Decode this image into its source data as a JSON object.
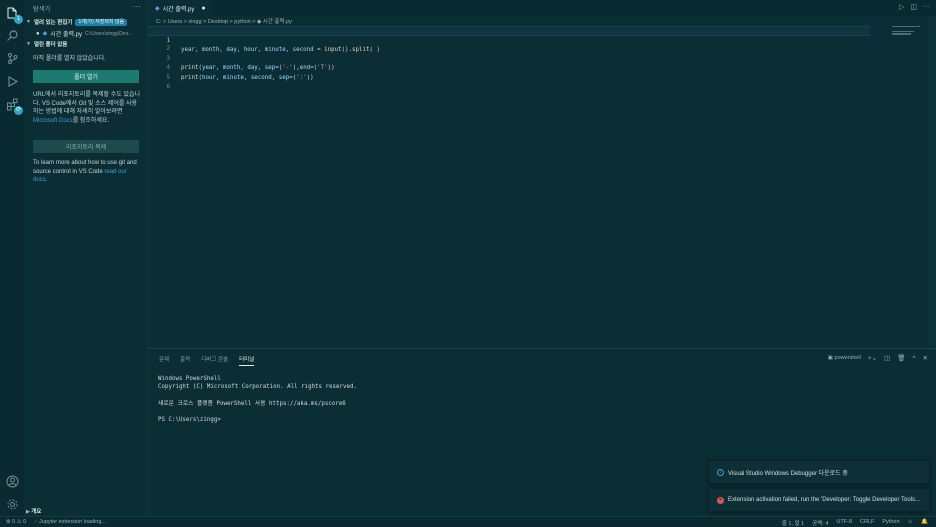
{
  "sidebar": {
    "title": "탐색기",
    "more": "···",
    "open_editors": {
      "label": "열려 있는 편집기",
      "badge": "1개(가) 저장되지 않음"
    },
    "open_file": {
      "name": "시간 출력.py",
      "path": "C:\\Users\\zingg\\Des..."
    },
    "no_folder": {
      "label": "열린 폴더 없음"
    },
    "no_folder_text": "아직 폴더를 열지 않았습니다.",
    "open_folder_button": "폴더 열기",
    "clone_text_1": "URL에서 리포지토리를 복제할 수도 있습니다. VS Code에서 Git 및 소스 제어를 사용하는 방법에 대해 자세히 알아보려면 ",
    "clone_text_link": "Microsoft Docs",
    "clone_text_2": "를 참조하세요.",
    "clone_button": "리포지토리 복제",
    "learn_text_1": "To learn more about how to use git and source control in VS Code ",
    "learn_text_link": "read our docs",
    "learn_text_2": ".",
    "outline": "개요"
  },
  "editor": {
    "tab": {
      "label": "시간 출력.py",
      "dirty": "●"
    },
    "breadcrumb": "C: > Users > zingg > Desktop > python > ◆ 시간 출력.py",
    "lines": [
      {
        "num": "1",
        "text": "year, month, day, hour, minute, second = input().split( )"
      },
      {
        "num": "2",
        "text": ""
      },
      {
        "num": "3",
        "text": "print(year, month, day, sep=('-'),end=('T'))"
      },
      {
        "num": "4",
        "text": "print(hour, minute, second, sep=(':'))"
      },
      {
        "num": "5",
        "text": ""
      },
      {
        "num": "6",
        "text": ""
      }
    ]
  },
  "panel": {
    "tabs": [
      "문제",
      "출력",
      "디버그 콘솔",
      "터미널"
    ],
    "active_tab": "터미널",
    "shell": "powershell",
    "terminal_lines": [
      "Windows PowerShell",
      "Copyright (C) Microsoft Corporation. All rights reserved.",
      "",
      "새로운 크로스 플랫폼 PowerShell 사용 https://aka.ms/pscore6",
      "",
      "PS C:\\Users\\zingg>"
    ]
  },
  "notifications": [
    {
      "type": "info",
      "text": "Visual Studio Windows Debugger 다운로드 중"
    },
    {
      "type": "error",
      "text": "Extension activation failed, run the 'Developer: Toggle Developer Tools..."
    }
  ],
  "statusbar": {
    "problems": "⊗ 0 ⚠ 0",
    "jupyter": "Jupyter extension loading...",
    "position": "줄 1, 열 1",
    "spaces": "공백: 4",
    "encoding": "UTF-8",
    "eol": "CRLF",
    "language": "Python"
  }
}
